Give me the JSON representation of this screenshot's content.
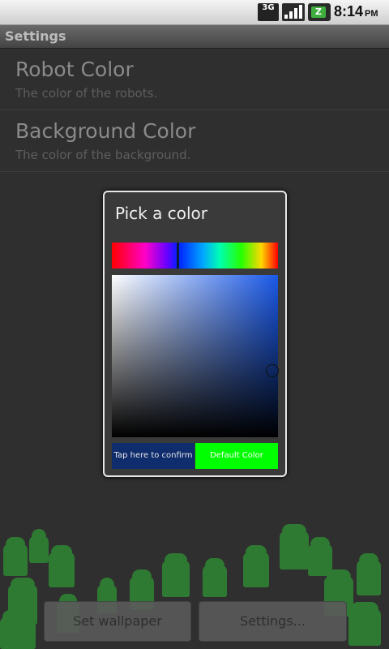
{
  "status_bar": {
    "network": "3G",
    "time": "8:14",
    "ampm": "PM"
  },
  "title_bar": {
    "title": "Settings"
  },
  "preferences": [
    {
      "title": "Robot Color",
      "summary": "The color of the robots."
    },
    {
      "title": "Background Color",
      "summary": "The color of the background."
    }
  ],
  "dialog": {
    "title": "Pick a color",
    "confirm_label": "Tap here to confirm",
    "default_label": "Default Color",
    "selected_color": "#0f2c6d",
    "default_color": "#00ff00"
  },
  "bottom_buttons": {
    "set_wallpaper": "Set wallpaper",
    "settings": "Settings..."
  }
}
